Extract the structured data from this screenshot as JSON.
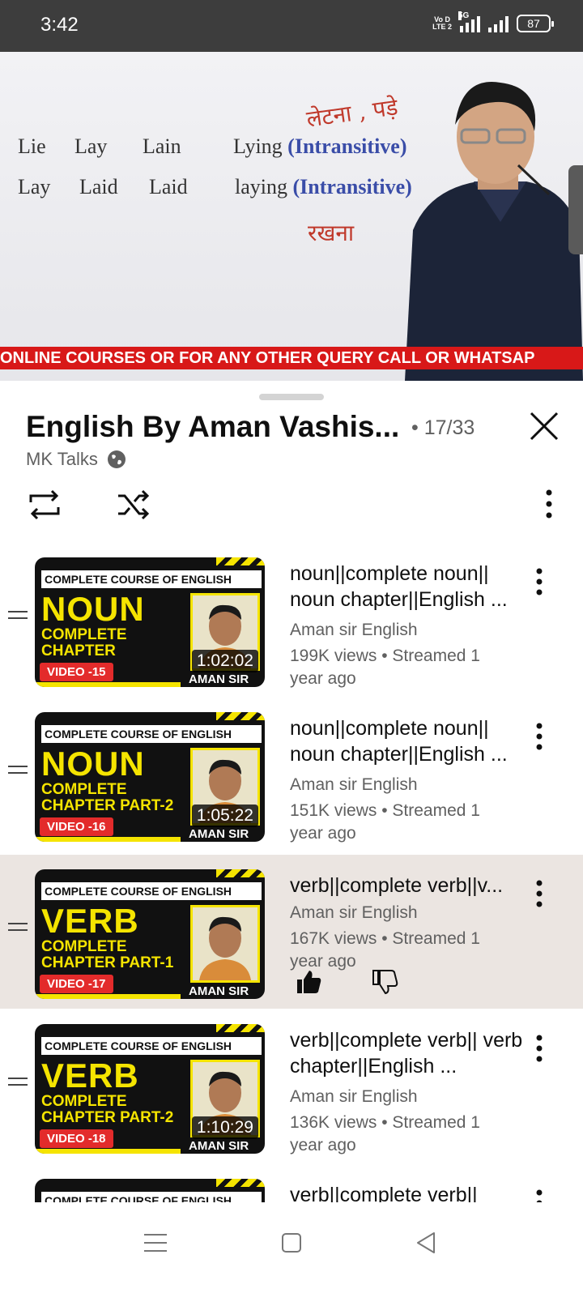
{
  "status_bar": {
    "time": "3:42",
    "volte_line1": "Vo D",
    "volte_line2": "LTE 2",
    "network": "5G",
    "battery": "87"
  },
  "player": {
    "board_rows": [
      {
        "words": [
          "Lie",
          "Lay",
          "Lain",
          "Lying"
        ],
        "tag": "(Intransitive)"
      },
      {
        "words": [
          "Lay",
          "Laid",
          "Laid",
          "laying"
        ],
        "tag": "(Intransitive)"
      }
    ],
    "hindi_top": "लेटना , पड़े",
    "hindi_bottom": "रखना",
    "ticker": "ONLINE COURSES OR FOR ANY OTHER QUERY CALL OR WHATSAP"
  },
  "playlist": {
    "title": "English By Aman Vashis...",
    "count": "• 17/33",
    "channel": "MK Talks"
  },
  "videos": [
    {
      "banner": "COMPLETE COURSE OF ENGLISH",
      "big": "NOUN",
      "sub1": "COMPLETE",
      "sub2": "CHAPTER",
      "tag": "VIDEO -15",
      "brand": "AMAN SIR",
      "duration": "1:02:02",
      "title": "noun||complete noun|| noun chapter||English ...",
      "channel": "Aman sir English",
      "meta": "199K views • Streamed 1 year ago",
      "active": false
    },
    {
      "banner": "COMPLETE COURSE OF ENGLISH",
      "big": "NOUN",
      "sub1": "COMPLETE",
      "sub2": "CHAPTER PART-2",
      "tag": "VIDEO -16",
      "brand": "AMAN SIR",
      "duration": "1:05:22",
      "title": "noun||complete noun|| noun chapter||English ...",
      "channel": "Aman sir English",
      "meta": "151K views • Streamed 1 year ago",
      "active": false
    },
    {
      "banner": "COMPLETE COURSE OF ENGLISH",
      "big": "VERB",
      "sub1": "COMPLETE",
      "sub2": "CHAPTER PART-1",
      "tag": "VIDEO -17",
      "brand": "AMAN SIR",
      "duration": "",
      "title": "verb||complete verb||v...",
      "channel": "Aman sir English",
      "meta": "167K views • Streamed 1 year ago",
      "active": true
    },
    {
      "banner": "COMPLETE COURSE OF ENGLISH",
      "big": "VERB",
      "sub1": "COMPLETE",
      "sub2": "CHAPTER PART-2",
      "tag": "VIDEO -18",
      "brand": "AMAN SIR",
      "duration": "1:10:29",
      "title": "verb||complete verb|| verb chapter||English ...",
      "channel": "Aman sir English",
      "meta": "136K views • Streamed 1 year ago",
      "active": false
    },
    {
      "banner": "COMPLETE COURSE OF ENGLISH",
      "title": "verb||complete verb||"
    }
  ],
  "colors": {
    "ticker": "#d81818",
    "thumb_yellow": "#f5e400",
    "active_row": "#ebe5e1",
    "tag_red": "#e32b2b"
  }
}
